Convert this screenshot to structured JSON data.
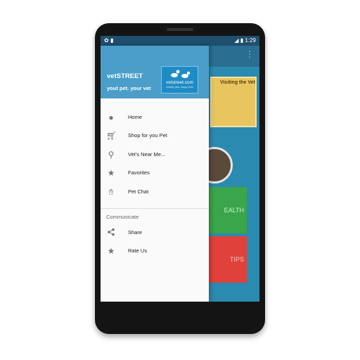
{
  "status_bar": {
    "time": "1:29",
    "left_icons": [
      "paw-icon",
      "sd-card-icon"
    ],
    "right_icons": [
      "signal-icon",
      "battery-icon"
    ]
  },
  "drawer": {
    "header": {
      "app_name": "vetSTREET",
      "tagline": "yout pet. your vet",
      "logo_text": "vetstreet.com",
      "logo_subtext": "healthy pets, happy lives"
    },
    "items": [
      {
        "label": "Home",
        "icon": "info-alert-icon"
      },
      {
        "label": "Shop for you Pet",
        "icon": "cart-icon"
      },
      {
        "label": "Vet's Near Me...",
        "icon": "location-pin-icon"
      },
      {
        "label": "Favorites",
        "icon": "star-icon"
      },
      {
        "label": "Pet Chat",
        "icon": "hand-icon"
      }
    ],
    "section_label": "Communicate",
    "section_items": [
      {
        "label": "Share",
        "icon": "share-icon"
      },
      {
        "label": "Rate Us",
        "icon": "star-icon"
      }
    ]
  },
  "background": {
    "card_title": "Visiting the Vet",
    "health_label": "EALTH",
    "tips_label": "TIPS"
  },
  "colors": {
    "drawer_header": "#4a9ec9",
    "health_tile": "#3aa54a",
    "tips_tile": "#e0413a",
    "status_bar": "#1f4f6e"
  }
}
